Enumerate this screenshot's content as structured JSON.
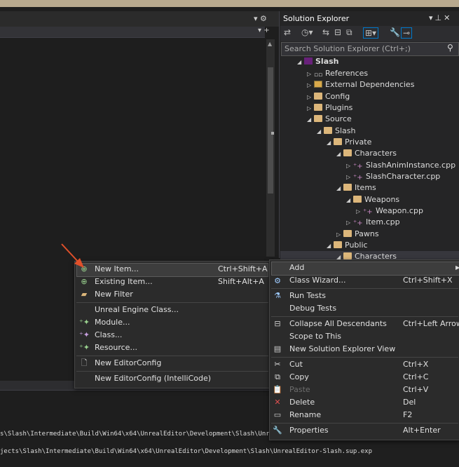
{
  "solution_explorer": {
    "title": "Solution Explorer",
    "search_placeholder": "Search Solution Explorer (Ctrl+;)",
    "tree": [
      {
        "label": "Slash",
        "icon": "vs-solution-icon"
      },
      {
        "label": "References",
        "icon": "references-icon"
      },
      {
        "label": "External Dependencies",
        "icon": "external-deps-icon"
      },
      {
        "label": "Config",
        "icon": "filter-folder-icon"
      },
      {
        "label": "Plugins",
        "icon": "filter-folder-icon"
      },
      {
        "label": "Source",
        "icon": "filter-folder-icon"
      },
      {
        "label": "Slash",
        "icon": "filter-folder-icon"
      },
      {
        "label": "Private",
        "icon": "filter-folder-icon"
      },
      {
        "label": "Characters",
        "icon": "filter-folder-icon"
      },
      {
        "label": "SlashAnimInstance.cpp",
        "icon": "cpp-file-icon"
      },
      {
        "label": "SlashCharacter.cpp",
        "icon": "cpp-file-icon"
      },
      {
        "label": "Items",
        "icon": "filter-folder-icon"
      },
      {
        "label": "Weapons",
        "icon": "filter-folder-icon"
      },
      {
        "label": "Weapon.cpp",
        "icon": "cpp-file-icon"
      },
      {
        "label": "Item.cpp",
        "icon": "cpp-file-icon"
      },
      {
        "label": "Pawns",
        "icon": "filter-folder-icon"
      },
      {
        "label": "Public",
        "icon": "filter-folder-icon"
      },
      {
        "label": "Characters",
        "icon": "filter-folder-icon"
      }
    ]
  },
  "context_menu": {
    "items": [
      {
        "label": "Add",
        "shortcut": ""
      },
      {
        "label": "Class Wizard...",
        "shortcut": "Ctrl+Shift+X"
      },
      {
        "label": "Run Tests",
        "shortcut": ""
      },
      {
        "label": "Debug Tests",
        "shortcut": ""
      },
      {
        "label": "Collapse All Descendants",
        "shortcut": "Ctrl+Left Arrow"
      },
      {
        "label": "Scope to This",
        "shortcut": ""
      },
      {
        "label": "New Solution Explorer View",
        "shortcut": ""
      },
      {
        "label": "Cut",
        "shortcut": "Ctrl+X"
      },
      {
        "label": "Copy",
        "shortcut": "Ctrl+C"
      },
      {
        "label": "Paste",
        "shortcut": "Ctrl+V"
      },
      {
        "label": "Delete",
        "shortcut": "Del"
      },
      {
        "label": "Rename",
        "shortcut": "F2"
      },
      {
        "label": "Properties",
        "shortcut": "Alt+Enter"
      }
    ]
  },
  "add_submenu": {
    "items": [
      {
        "label": "New Item...",
        "shortcut": "Ctrl+Shift+A"
      },
      {
        "label": "Existing Item...",
        "shortcut": "Shift+Alt+A"
      },
      {
        "label": "New Filter",
        "shortcut": ""
      },
      {
        "label": "Unreal Engine Class...",
        "shortcut": ""
      },
      {
        "label": "Module...",
        "shortcut": ""
      },
      {
        "label": "Class...",
        "shortcut": ""
      },
      {
        "label": "Resource...",
        "shortcut": ""
      },
      {
        "label": "New EditorConfig",
        "shortcut": ""
      },
      {
        "label": "New EditorConfig (IntelliCode)",
        "shortcut": ""
      }
    ]
  },
  "output": {
    "lines": [
      "s\\Slash\\Intermediate\\Build\\Win64\\x64\\UnrealEditor\\Development\\Slash\\UnrealEdit",
      "jects\\Slash\\Intermediate\\Build\\Win64\\x64\\UnrealEditor\\Development\\Slash\\UnrealEditor-Slash.sup.exp"
    ]
  },
  "colors": {
    "accent": "#007acc",
    "arrow": "#e0502a",
    "cpp_icon": "#c586c0",
    "folder": "#dcb67a"
  }
}
